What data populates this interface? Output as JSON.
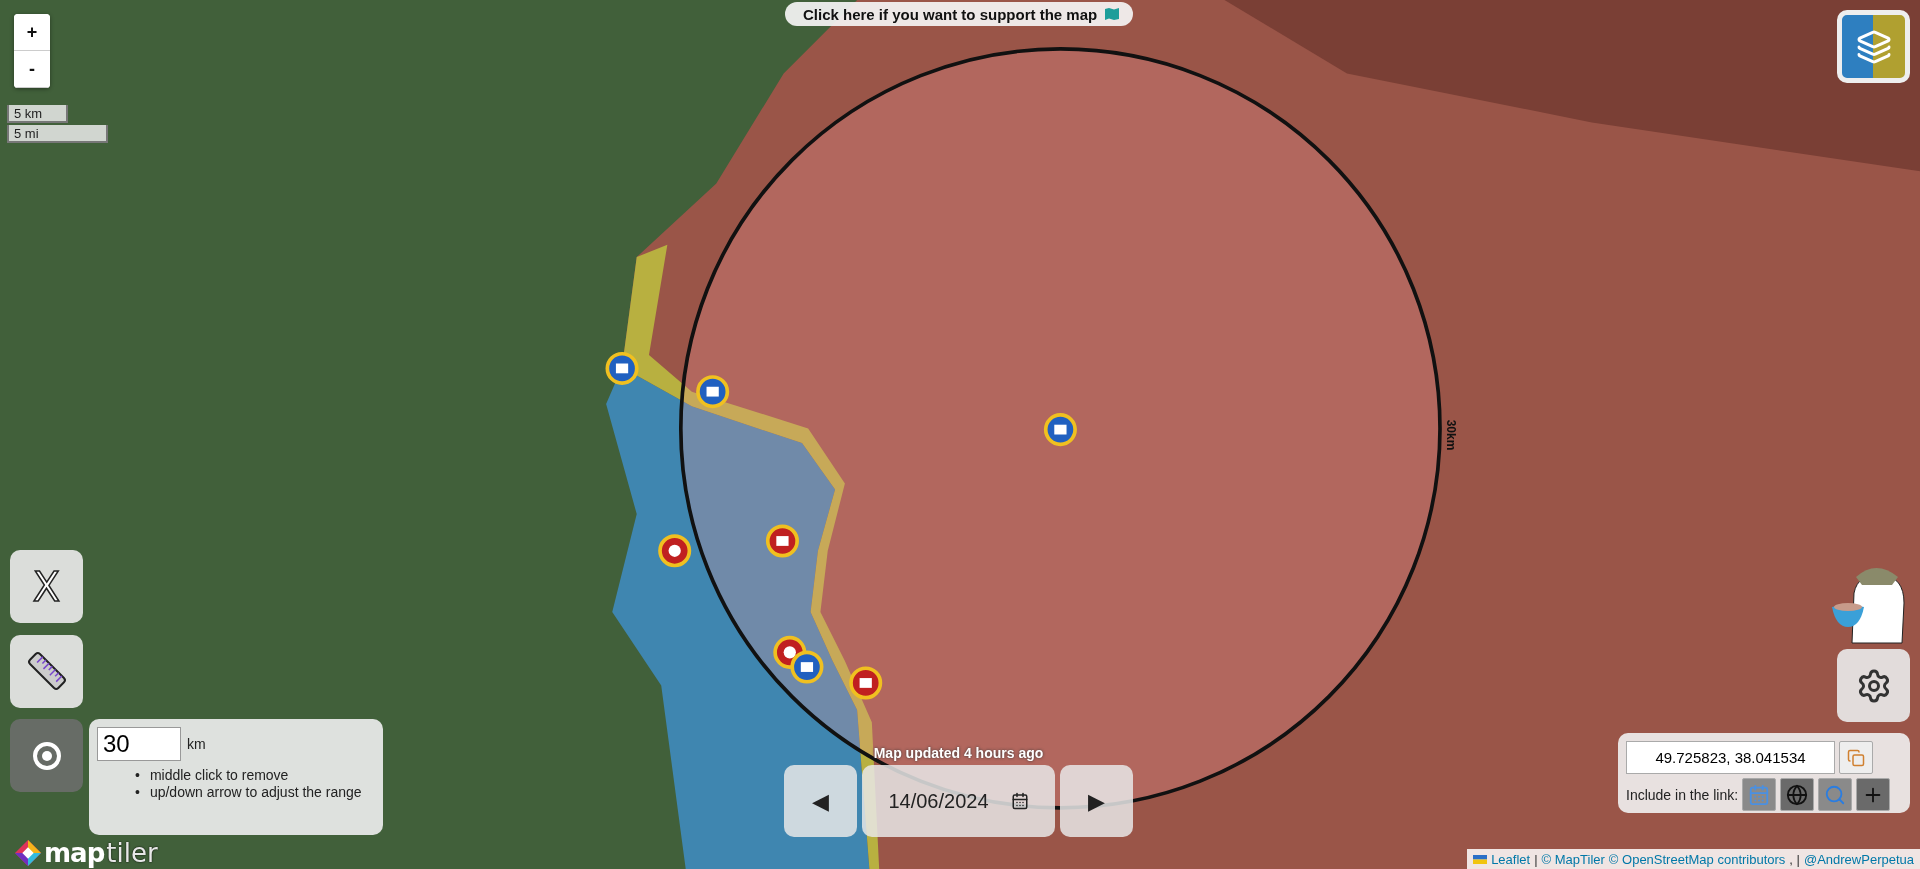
{
  "support_button": {
    "label": "Click here if you want to support the map"
  },
  "zoom_controls": [
    "+",
    "-"
  ],
  "scale": [
    "5 km",
    "5 mi"
  ],
  "tools": [
    {
      "kind": "close",
      "label": "X",
      "selected": false
    },
    {
      "kind": "ruler",
      "selected": false
    },
    {
      "kind": "target",
      "selected": true
    }
  ],
  "range_panel": {
    "value": "30",
    "unit": "km",
    "bullet": "•",
    "hints": [
      "middle click to remove",
      "up/down arrow to adjust the range"
    ]
  },
  "range_circle": {
    "label": "30km"
  },
  "map_logo": {
    "brand": "map",
    "suffix": "tiler"
  },
  "date_nav": {
    "update_note": "Map updated 4 hours ago",
    "prev": "◀",
    "date": "14/06/2024",
    "next": "▶"
  },
  "link_panel": {
    "coordinates": "49.725823, 38.041534",
    "include_label": "Include in the link:",
    "options": [
      {
        "kind": "date",
        "on": true
      },
      {
        "kind": "world",
        "on": false
      },
      {
        "kind": "zoom",
        "on": true
      },
      {
        "kind": "position",
        "on": false
      }
    ]
  },
  "attribution": [
    {
      "text": "Leaflet",
      "kind": "link"
    },
    {
      "text": "|",
      "kind": "plain"
    },
    {
      "text": "© MapTiler",
      "kind": "link"
    },
    {
      "text": "© OpenStreetMap contributors",
      "kind": "link"
    },
    {
      "text": ", |",
      "kind": "plain"
    },
    {
      "text": "@AndrewPerpetua",
      "kind": "link"
    }
  ]
}
